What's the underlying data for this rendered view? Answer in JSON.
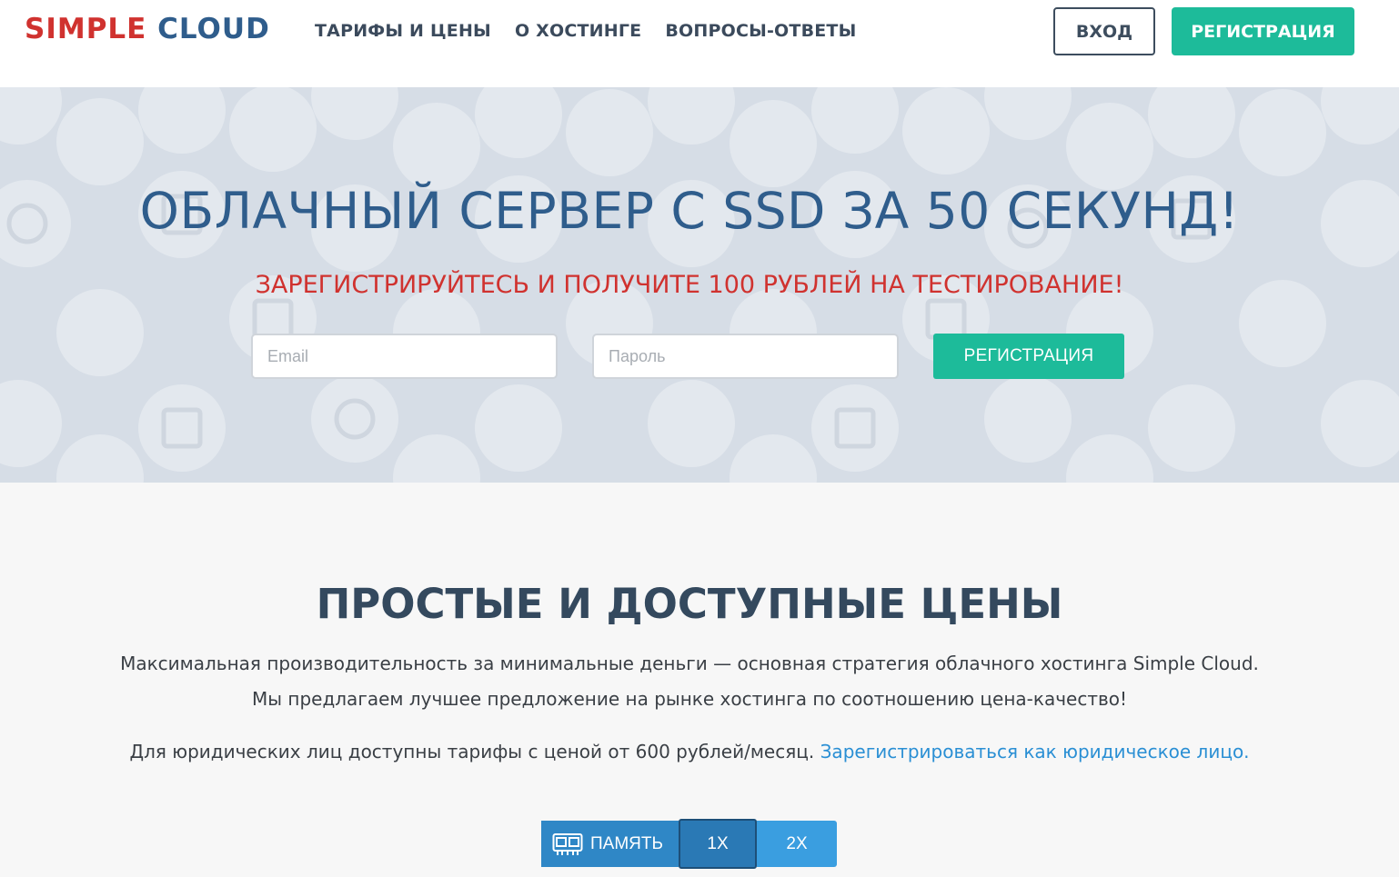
{
  "header": {
    "logo_part1": "SIMPLE",
    "logo_part2": "CLOUD",
    "nav": [
      {
        "label": "ТАРИФЫ И ЦЕНЫ"
      },
      {
        "label": "О ХОСТИНГЕ"
      },
      {
        "label": "ВОПРОСЫ-ОТВЕТЫ"
      }
    ],
    "login_label": "ВХОД",
    "register_label": "РЕГИСТРАЦИЯ"
  },
  "hero": {
    "title": "ОБЛАЧНЫЙ СЕРВЕР С SSD ЗА 50 СЕКУНД!",
    "subtitle": "ЗАРЕГИСТРИРУЙТЕСЬ И ПОЛУЧИТЕ 100 РУБЛЕЙ НА ТЕСТИРОВАНИЕ!",
    "email_placeholder": "Email",
    "password_placeholder": "Пароль",
    "register_label": "РЕГИСТРАЦИЯ"
  },
  "pricing": {
    "title": "ПРОСТЫЕ И ДОСТУПНЫЕ ЦЕНЫ",
    "line1": "Максимальная производительность за минимальные деньги — основная стратегия облачного хостинга Simple Cloud.",
    "line2": "Мы предлагаем лучшее предложение на рынке хостинга по соотношению цена-качество!",
    "line3": "Для юридических лиц доступны тарифы с ценой от 600 рублей/месяц.",
    "legal_link": "Зарегистрироваться как юридическое лицо.",
    "memory_label": "ПАМЯТЬ",
    "memory_options": [
      "1X",
      "2X"
    ],
    "memory_selected": "1X"
  },
  "colors": {
    "brand_red": "#d0322f",
    "brand_blue": "#2f5d8c",
    "accent_green": "#1dbb9a",
    "switch_blue": "#2f87c6",
    "link_blue": "#2a8fd4"
  }
}
